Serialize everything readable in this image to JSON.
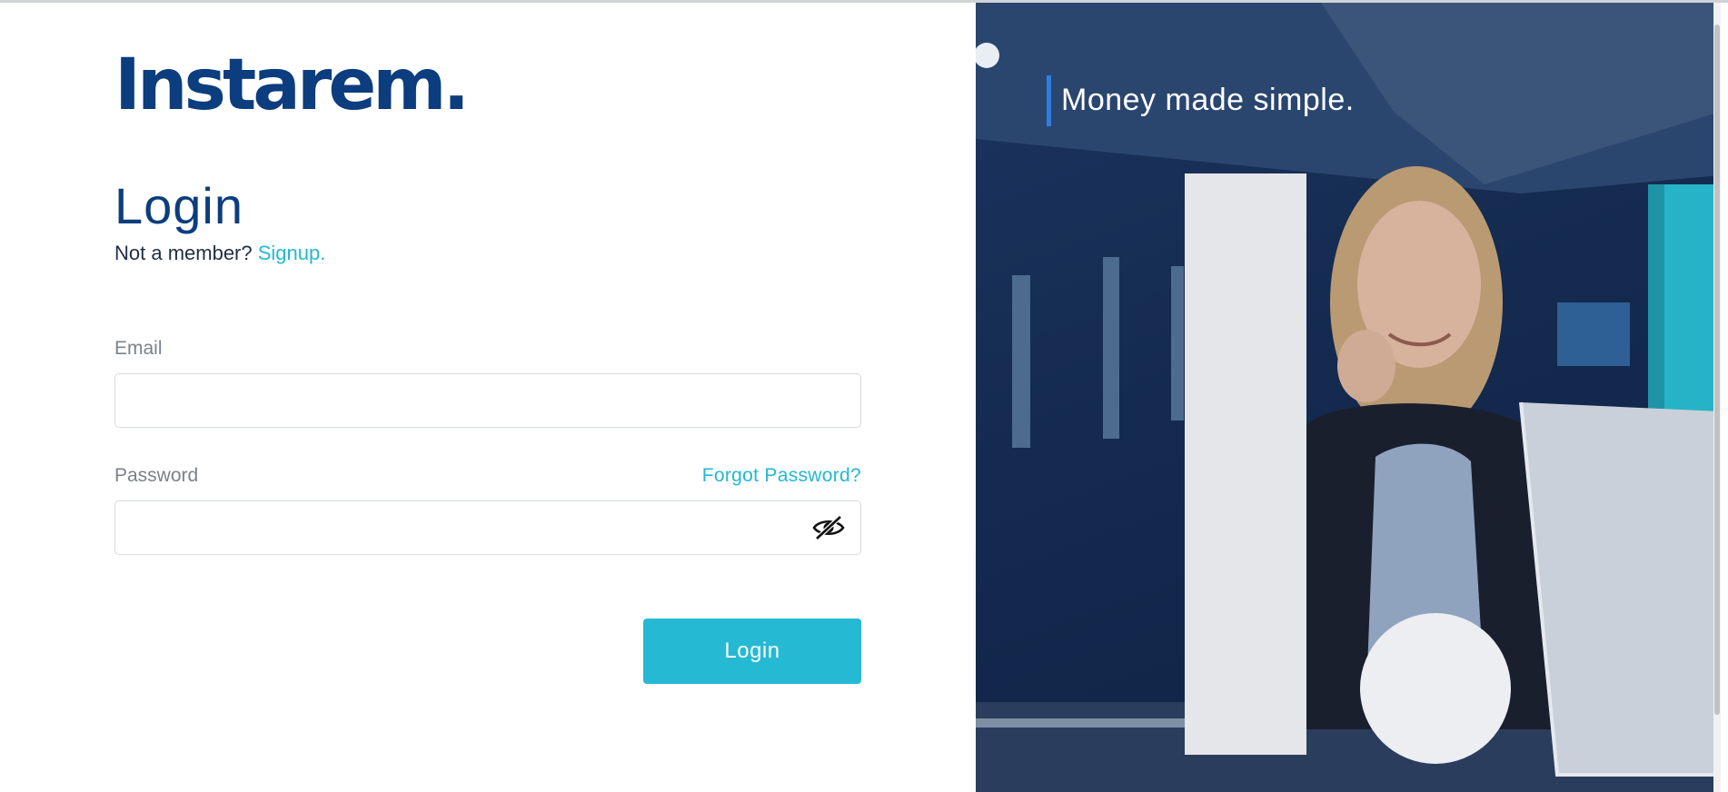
{
  "brand": {
    "logo_text": "Instarem."
  },
  "login_form": {
    "title": "Login",
    "member_prompt": "Not a member?",
    "signup_link": "Signup.",
    "email_label": "Email",
    "email_value": "",
    "password_label": "Password",
    "password_value": "",
    "forgot_password_link": "Forgot Password?",
    "password_toggle_icon": "eye-slash-icon",
    "submit_label": "Login"
  },
  "hero": {
    "tagline": "Money made simple."
  },
  "colors": {
    "brand_navy": "#0c3d7e",
    "accent_teal": "#25b9d4",
    "hero_background": "#142a4f",
    "tagline_bar": "#2f7fe0"
  }
}
